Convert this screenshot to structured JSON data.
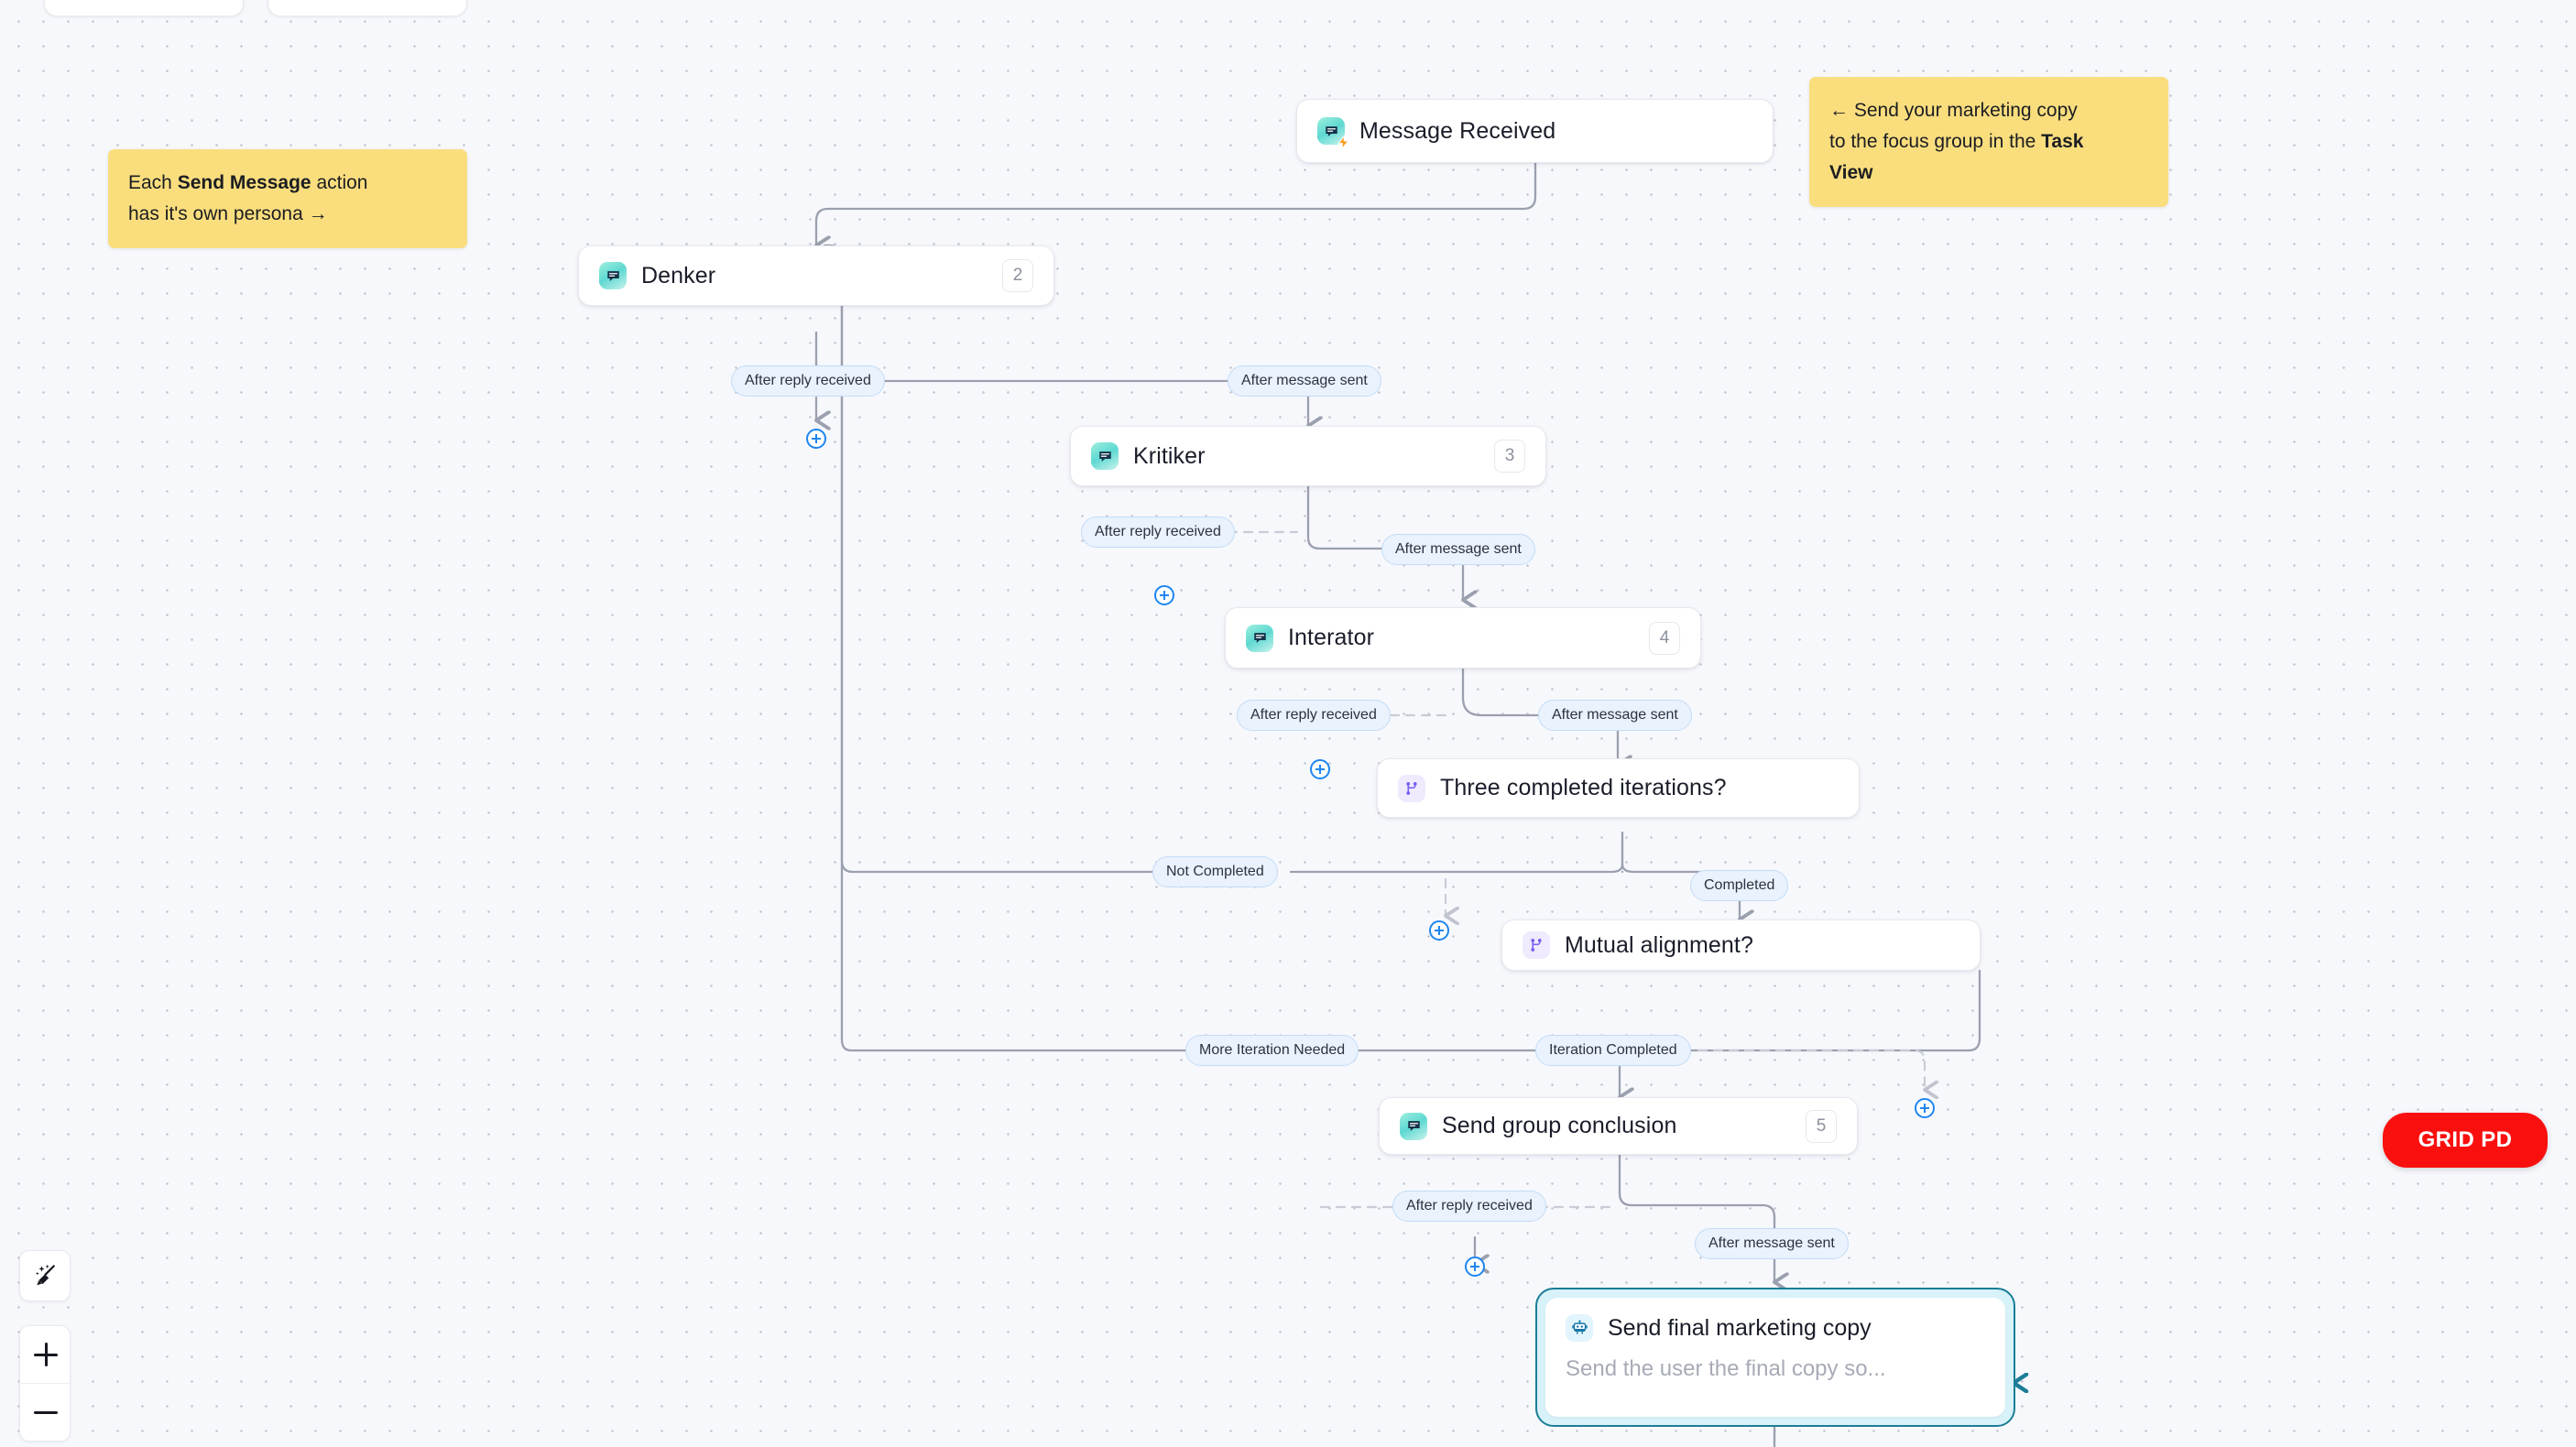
{
  "canvas": {
    "background_color": "#f7f8fc",
    "dot_color": "#c9cbd6"
  },
  "peek_cards": [
    {
      "name": "peek-card-left",
      "icon_color": "#f7dfa0"
    },
    {
      "name": "peek-card-right",
      "icon_color": "#f6d7e2"
    }
  ],
  "sticky_notes": [
    {
      "id": "note-persona",
      "color": "#fade7e",
      "line1_pre": "Each ",
      "line1_bold": "Send Message",
      "line1_post": " action",
      "line2": "has it's own persona →"
    },
    {
      "id": "note-task-view",
      "color": "#fade7e",
      "line1": "← Send your marketing copy",
      "line2_pre": "to the focus group in the ",
      "line2_bold": "Task",
      "line3_bold": "View"
    }
  ],
  "nodes": [
    {
      "id": "message-received",
      "title": "Message Received",
      "icon": "message-icon",
      "badge": null,
      "trigger": true
    },
    {
      "id": "denker",
      "title": "Denker",
      "icon": "message-icon",
      "badge": "2",
      "trigger": false
    },
    {
      "id": "kritiker",
      "title": "Kritiker",
      "icon": "message-icon",
      "badge": "3",
      "trigger": false
    },
    {
      "id": "interator",
      "title": "Interator",
      "icon": "message-icon",
      "badge": "4",
      "trigger": false
    },
    {
      "id": "three-iterations",
      "title": "Three completed iterations?",
      "icon": "branch-icon",
      "badge": null,
      "trigger": false
    },
    {
      "id": "mutual-alignment",
      "title": "Mutual alignment?",
      "icon": "branch-icon",
      "badge": null,
      "trigger": false
    },
    {
      "id": "send-group-conclusion",
      "title": "Send group conclusion",
      "icon": "message-icon",
      "badge": "5",
      "trigger": false
    }
  ],
  "selected_node": {
    "id": "send-final-marketing-copy",
    "title": "Send final marketing copy",
    "subtitle": "Send the user the final copy so...",
    "icon": "robot-icon",
    "selection_color": "#1b7e96",
    "selection_fill": "#d8f2fa"
  },
  "edge_labels": [
    {
      "id": "denker-after-reply",
      "text": "After reply received"
    },
    {
      "id": "denker-after-sent",
      "text": "After message sent"
    },
    {
      "id": "kritiker-after-reply",
      "text": "After reply received"
    },
    {
      "id": "kritiker-after-sent",
      "text": "After message sent"
    },
    {
      "id": "interator-after-reply",
      "text": "After reply received"
    },
    {
      "id": "interator-after-sent",
      "text": "After message sent"
    },
    {
      "id": "iter-not-completed",
      "text": "Not Completed"
    },
    {
      "id": "iter-completed",
      "text": "Completed"
    },
    {
      "id": "align-more-iteration",
      "text": "More Iteration Needed"
    },
    {
      "id": "align-iteration-done",
      "text": "Iteration Completed"
    },
    {
      "id": "conclusion-after-reply",
      "text": "After reply received"
    },
    {
      "id": "conclusion-after-sent",
      "text": "After message sent"
    }
  ],
  "add_buttons": [
    {
      "id": "add-after-denker-reply"
    },
    {
      "id": "add-after-kritiker-reply"
    },
    {
      "id": "add-after-interator-reply"
    },
    {
      "id": "add-after-not-completed"
    },
    {
      "id": "add-after-iteration-completed"
    },
    {
      "id": "add-after-conclusion-reply"
    }
  ],
  "controls": {
    "magic_clean": {
      "id": "magic-clean-button",
      "icon": "magic-broom-icon"
    },
    "zoom_in": {
      "id": "zoom-in-button",
      "icon": "plus-icon"
    },
    "zoom_out": {
      "id": "zoom-out-button",
      "icon": "minus-icon"
    }
  },
  "brand_button": {
    "label": "GRID PD",
    "color": "#fa0f0f",
    "text_color": "#ffffff"
  }
}
